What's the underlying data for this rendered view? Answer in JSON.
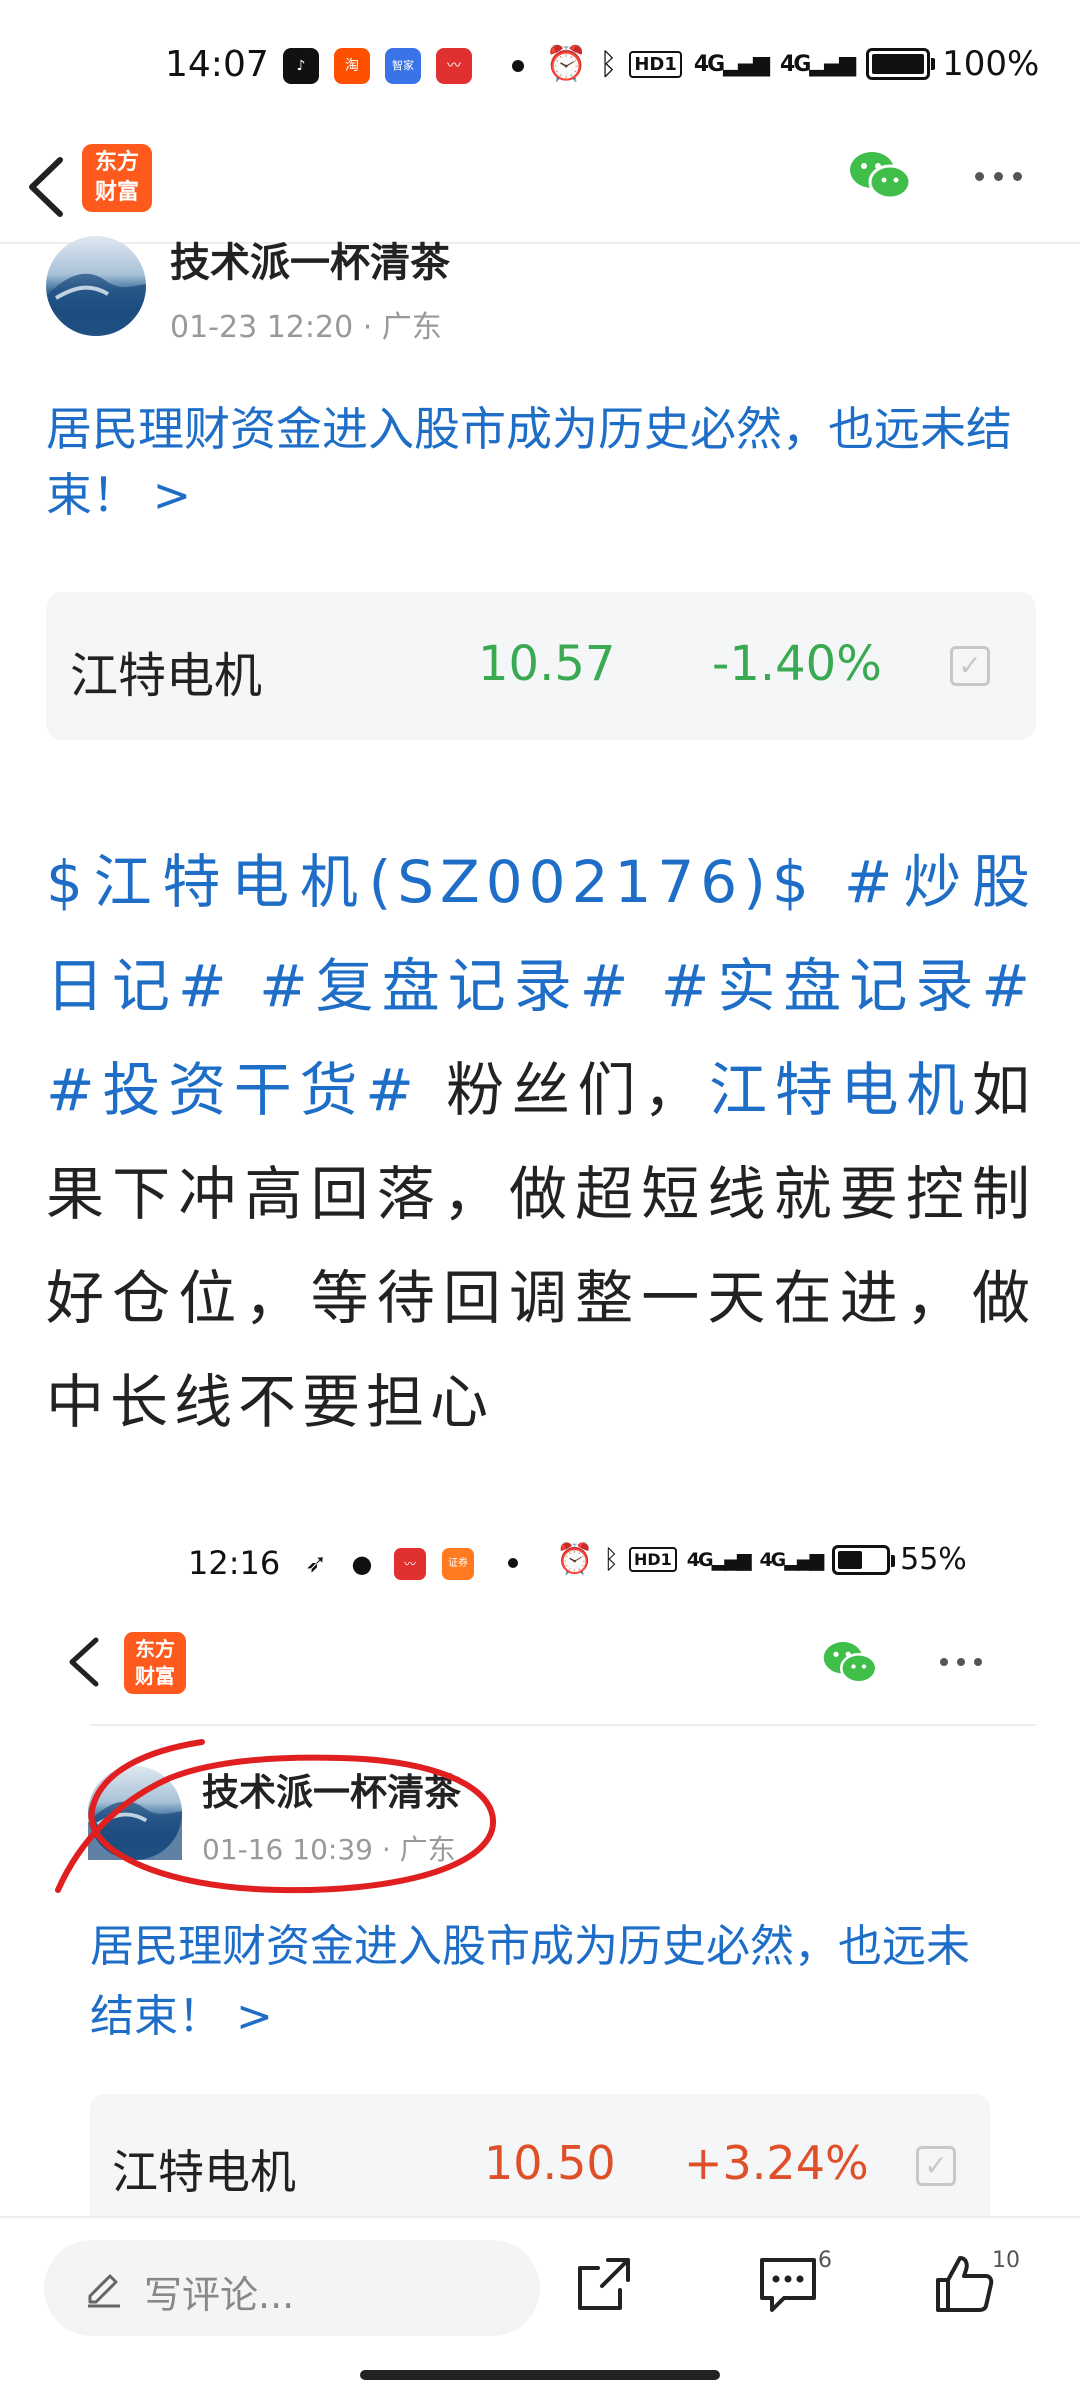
{
  "status_bar": {
    "time": "14:07",
    "apps": [
      {
        "name": "tiktok-icon",
        "color": "#111111",
        "label": "♪"
      },
      {
        "name": "taobao-icon",
        "color": "#ff5000",
        "label": "淘"
      },
      {
        "name": "baidu-icon",
        "color": "#3a73e8",
        "label": "智家"
      },
      {
        "name": "eastmoney-icon",
        "color": "#e03030",
        "label": "~"
      }
    ],
    "network": "4G",
    "network2": "4G",
    "hd": "HD1",
    "battery": "100%",
    "battery_level": 1.0
  },
  "nav": {
    "logo_line1": "东方",
    "logo_line2": "财富"
  },
  "post": {
    "author": "技术派一杯清茶",
    "timestamp": "01-23 12:20",
    "location": "· 广东",
    "link_title": "居民理财资金进入股市成为历史必然，也远未结束！ >",
    "stock": {
      "name": "江特电机",
      "price": "10.57",
      "change": "-1.40%",
      "color": "#3aaa52"
    },
    "body": {
      "stock_tag": "$江特电机(SZ002176)$",
      "tag1": "#炒股日记#",
      "tag2": "#复盘记录#",
      "tag3": "#实盘记录#",
      "tag4": "#投资干货#",
      "text1": "粉丝们，",
      "stock_link": "江特电机",
      "text2": "如果下冲高回落，做超短线就要控制好仓位，等待回调整一天在进，做中长线不要担心"
    }
  },
  "embedded": {
    "time": "12:16",
    "battery": "55%",
    "battery_level": 0.55,
    "logo_line1": "东方",
    "logo_line2": "财富",
    "author": "技术派一杯清茶",
    "timestamp": "01-16 10:39",
    "location": "· 广东",
    "link_title": "居民理财资金进入股市成为历史必然，也远未结束！ >",
    "stock": {
      "name": "江特电机",
      "price": "10.50",
      "change": "+3.24%",
      "color": "#e05028"
    },
    "annotation_color": "#e02020"
  },
  "bottom_bar": {
    "comment_placeholder": "写评论...",
    "comment_count": "6",
    "like_count": "10"
  }
}
